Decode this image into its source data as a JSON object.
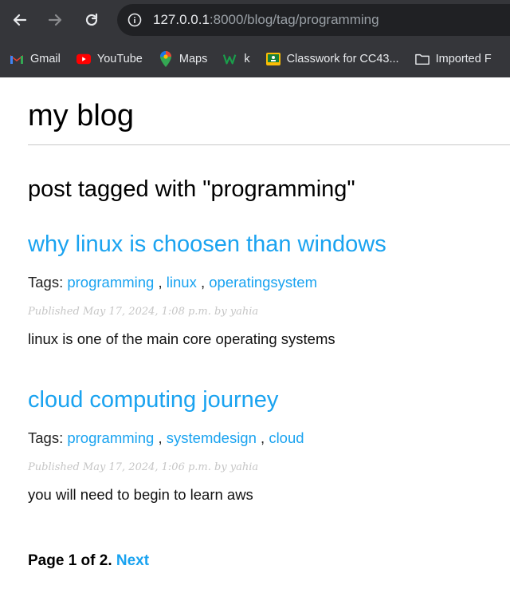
{
  "browser": {
    "url_host": "127.0.0.1",
    "url_rest": ":8000/blog/tag/programming",
    "bookmarks": [
      {
        "label": "Gmail",
        "icon": "gmail-icon"
      },
      {
        "label": "YouTube",
        "icon": "youtube-icon"
      },
      {
        "label": "Maps",
        "icon": "maps-icon"
      },
      {
        "label": "k",
        "icon": "w-icon"
      },
      {
        "label": "Classwork for CC43...",
        "icon": "classroom-icon"
      },
      {
        "label": "Imported F",
        "icon": "folder-icon"
      }
    ]
  },
  "site": {
    "title": "my blog",
    "tag_heading": "post tagged with \"programming\""
  },
  "posts": [
    {
      "title": "why linux is choosen than windows",
      "tags_label": "Tags:",
      "tags": [
        "programming",
        "linux",
        "operatingsystem"
      ],
      "published": "Published May 17, 2024, 1:08 p.m. by yahia",
      "body": "linux is one of the main core operating systems"
    },
    {
      "title": "cloud computing journey",
      "tags_label": "Tags:",
      "tags": [
        "programming",
        "systemdesign",
        "cloud"
      ],
      "published": "Published May 17, 2024, 1:06 p.m. by yahia",
      "body": "you will need to begin to learn aws"
    }
  ],
  "pagination": {
    "text": "Page 1 of 2.",
    "next_label": "Next"
  },
  "colors": {
    "link": "#1aa3f0",
    "chrome_bg": "#35363a"
  }
}
